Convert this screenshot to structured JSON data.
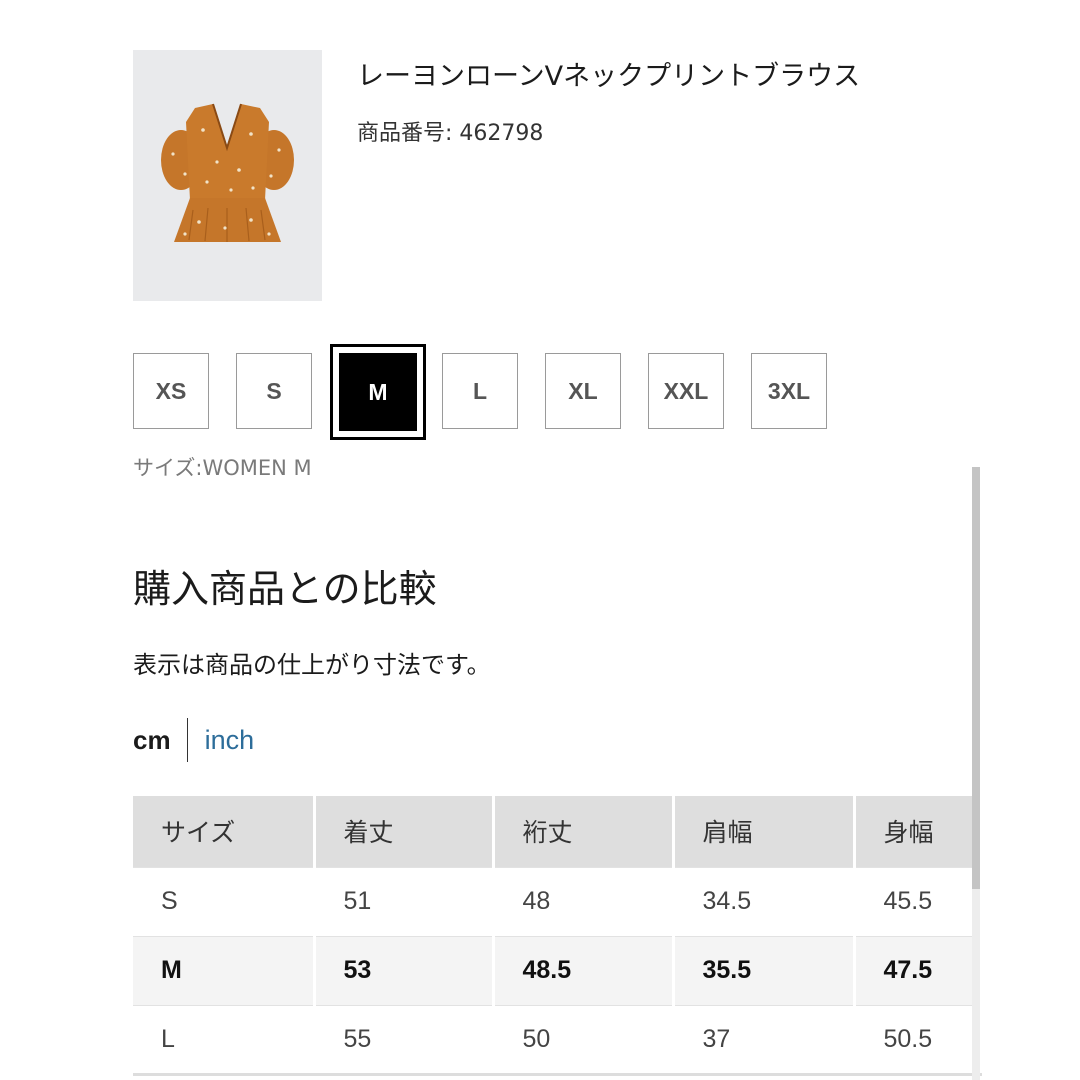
{
  "product": {
    "name": "レーヨンローンVネックプリントブラウス",
    "number": "商品番号: 462798",
    "image_icon": "blouse-image",
    "image_color": "#c5762a"
  },
  "sizes": [
    "XS",
    "S",
    "M",
    "L",
    "XL",
    "XXL",
    "3XL"
  ],
  "selected_size": "M",
  "size_label": "サイズ:WOMEN M",
  "section": {
    "title": "購入商品との比較",
    "note": "表示は商品の仕上がり寸法です。"
  },
  "units": {
    "cm": "cm",
    "inch": "inch",
    "active": "cm",
    "inch_color": "#2d6d9a"
  },
  "table": {
    "headers": [
      "サイズ",
      "着丈",
      "裄丈",
      "肩幅",
      "身幅"
    ],
    "rows": [
      [
        "S",
        "51",
        "48",
        "34.5",
        "45.5"
      ],
      [
        "M",
        "53",
        "48.5",
        "35.5",
        "47.5"
      ],
      [
        "L",
        "55",
        "50",
        "37",
        "50.5"
      ]
    ],
    "highlighted_row": "M"
  }
}
